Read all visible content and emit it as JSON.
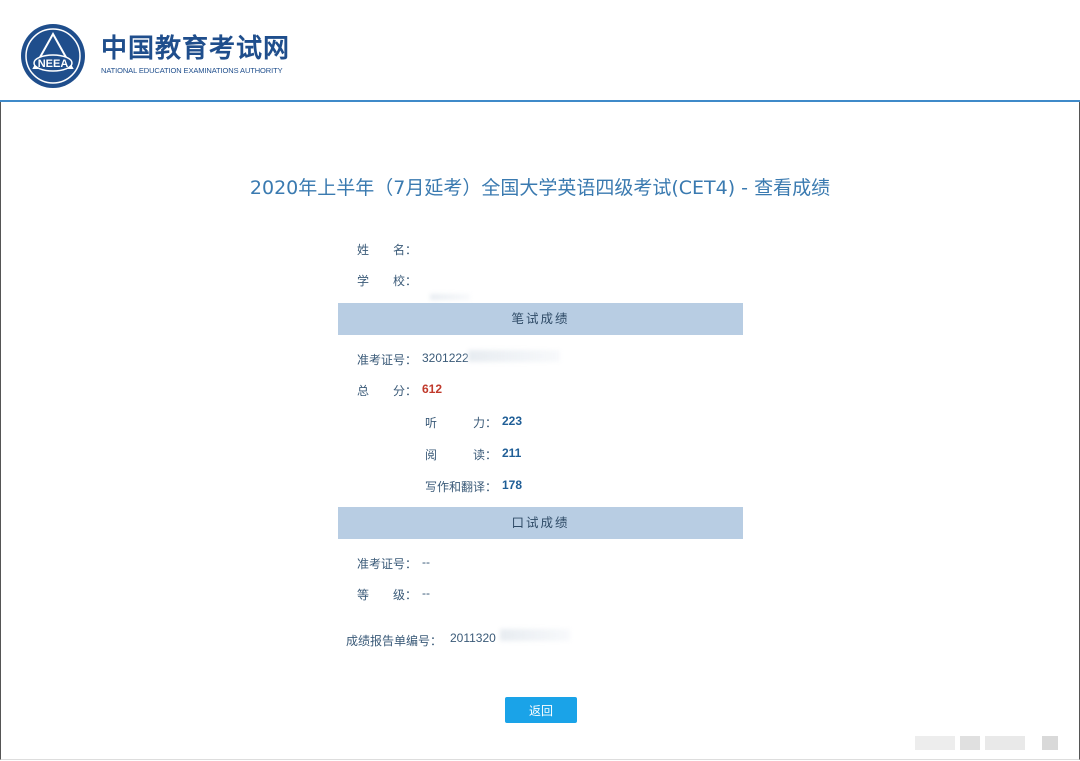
{
  "header": {
    "site_name": "中国教育考试网",
    "site_name_en": "NATIONAL EDUCATION EXAMINATIONS AUTHORITY",
    "logo_text": "NEEA",
    "accent_color": "#3f8ac9",
    "brand_color": "#1f4e8c"
  },
  "page": {
    "title": "2020年上半年（7月延考）全国大学英语四级考试(CET4) - 查看成绩"
  },
  "personal": {
    "name_label": "姓　　名：",
    "name_value": "",
    "school_label": "学　　校：",
    "school_value": ""
  },
  "written": {
    "section_title": "笔试成绩",
    "ticket_label": "准考证号：",
    "ticket_value": "3201222",
    "total_label": "总　　分：",
    "total_value": "612",
    "listening_label": "听　　　力：",
    "listening_value": "223",
    "reading_label": "阅　　　读：",
    "reading_value": "211",
    "writing_label": "写作和翻译：",
    "writing_value": "178"
  },
  "oral": {
    "section_title": "口试成绩",
    "ticket_label": "准考证号：",
    "ticket_value": "--",
    "grade_label": "等　　级：",
    "grade_value": "--"
  },
  "report": {
    "label": "成绩报告单编号：",
    "value": "2011320"
  },
  "actions": {
    "back_label": "返回",
    "back_color": "#1aa3e8"
  },
  "colors": {
    "total_score": "#c0392b",
    "sub_score": "#1f5e96",
    "section_bar": "#b8cde3"
  }
}
